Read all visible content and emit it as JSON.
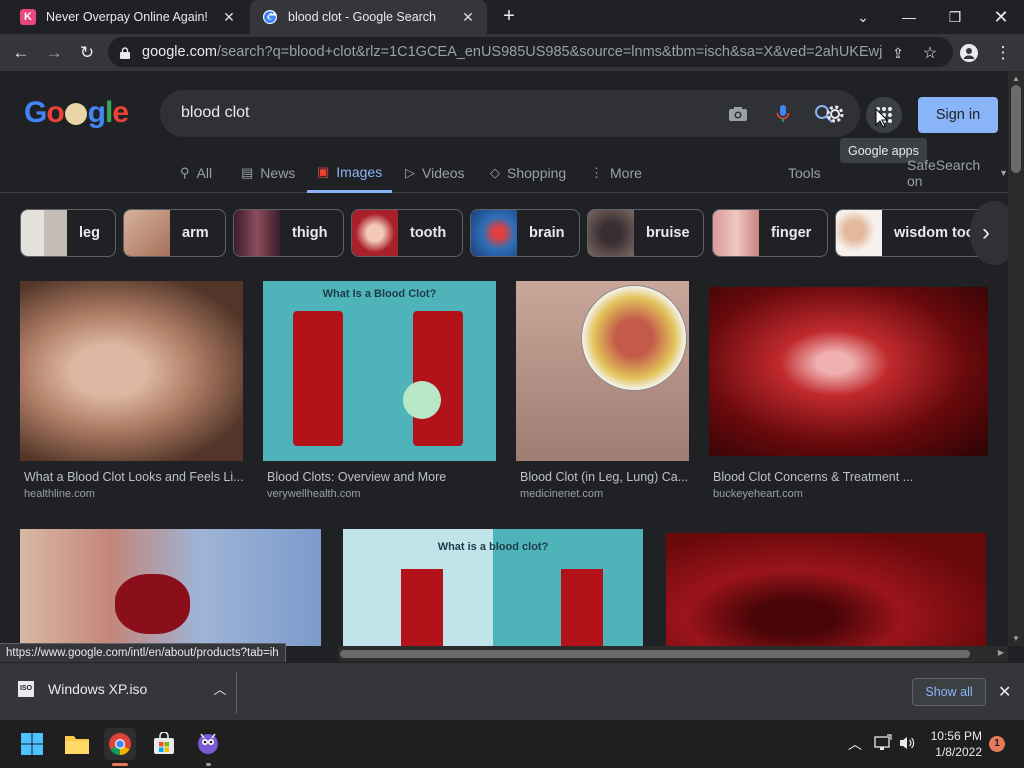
{
  "tabs": [
    {
      "title": "Never Overpay Online Again!",
      "favicon": "K",
      "favicon_color": "#e8467c"
    },
    {
      "title": "blood clot - Google Search",
      "favicon": "google-icon"
    }
  ],
  "address_bar": {
    "domain": "google.com",
    "path": "/search?q=blood+clot&rlz=1C1GCEA_enUS985US985&source=lnms&tbm=isch&sa=X&ved=2ahUKEwjX..."
  },
  "search": {
    "query": "blood clot",
    "sign_in_label": "Sign in",
    "apps_tooltip": "Google apps"
  },
  "nav_tabs": [
    {
      "label": "All",
      "icon": "search-icon"
    },
    {
      "label": "News",
      "icon": "news-icon"
    },
    {
      "label": "Images",
      "icon": "image-icon",
      "active": true
    },
    {
      "label": "Videos",
      "icon": "video-icon"
    },
    {
      "label": "Shopping",
      "icon": "tag-icon"
    },
    {
      "label": "More",
      "icon": "more-icon"
    }
  ],
  "tools_label": "Tools",
  "safesearch_label": "SafeSearch on",
  "chips": [
    {
      "label": "leg",
      "thumb_color": "#d9d4cf"
    },
    {
      "label": "arm",
      "thumb_color": "#c9a48d"
    },
    {
      "label": "thigh",
      "thumb_color": "#6b3a4a"
    },
    {
      "label": "tooth",
      "thumb_color": "#b8343c"
    },
    {
      "label": "brain",
      "thumb_color": "#3b7fc4"
    },
    {
      "label": "bruise",
      "thumb_color": "#5a4646"
    },
    {
      "label": "finger",
      "thumb_color": "#d8a3a0"
    },
    {
      "label": "wisdom too",
      "thumb_color": "#e8dad2"
    }
  ],
  "results": [
    {
      "title": "What a Blood Clot Looks and Feels Li...",
      "source": "healthline.com",
      "color": "#a97a63"
    },
    {
      "title": "Blood Clots: Overview and More",
      "source": "verywellhealth.com",
      "color": "#4fb4ba",
      "caption": "What Is a Blood Clot?"
    },
    {
      "title": "Blood Clot (in Leg, Lung) Ca...",
      "source": "medicinenet.com",
      "color": "#b4938b"
    },
    {
      "title": "Blood Clot Concerns & Treatment ...",
      "source": "buckeyeheart.com",
      "color": "#7a0f12"
    },
    {
      "color": "#b56f6a"
    },
    {
      "color": "#4fb4ba",
      "caption": "What is a blood clot?"
    },
    {
      "color": "#7d0b0e"
    }
  ],
  "status_url": "https://www.google.com/intl/en/about/products?tab=ih",
  "download": {
    "filename": "Windows XP.iso",
    "show_all_label": "Show all"
  },
  "taskbar": {
    "time": "10:56 PM",
    "date": "1/8/2022",
    "notification_count": "1"
  }
}
